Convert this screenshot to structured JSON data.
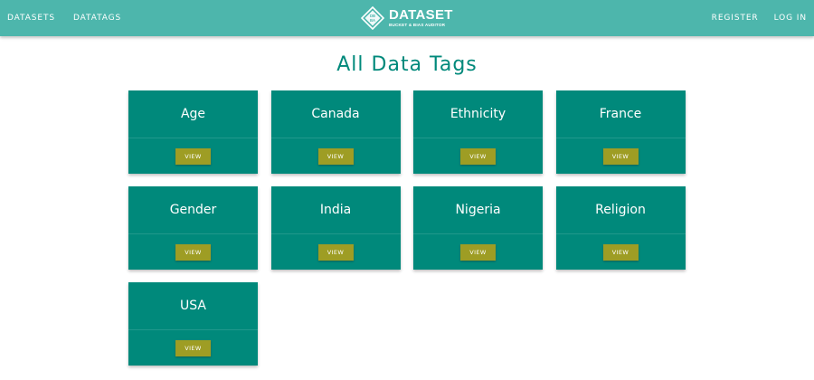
{
  "nav": {
    "left": [
      "DATASETS",
      "DATATAGS"
    ],
    "right": [
      "REGISTER",
      "LOG IN"
    ]
  },
  "brand": {
    "logo_text": [
      "DB",
      "BA"
    ],
    "title": "DATASET",
    "subtitle": "BUCKET & BIAS AUDITOR"
  },
  "page": {
    "title": "All Data Tags"
  },
  "tags": [
    {
      "name": "Age",
      "button": "VIEW"
    },
    {
      "name": "Canada",
      "button": "VIEW"
    },
    {
      "name": "Ethnicity",
      "button": "VIEW"
    },
    {
      "name": "France",
      "button": "VIEW"
    },
    {
      "name": "Gender",
      "button": "VIEW"
    },
    {
      "name": "India",
      "button": "VIEW"
    },
    {
      "name": "Nigeria",
      "button": "VIEW"
    },
    {
      "name": "Religion",
      "button": "VIEW"
    },
    {
      "name": "USA",
      "button": "VIEW"
    }
  ],
  "colors": {
    "navbar": "#4db6ac",
    "card": "#00897b",
    "title": "#00897b",
    "button": "#9e9d24"
  }
}
